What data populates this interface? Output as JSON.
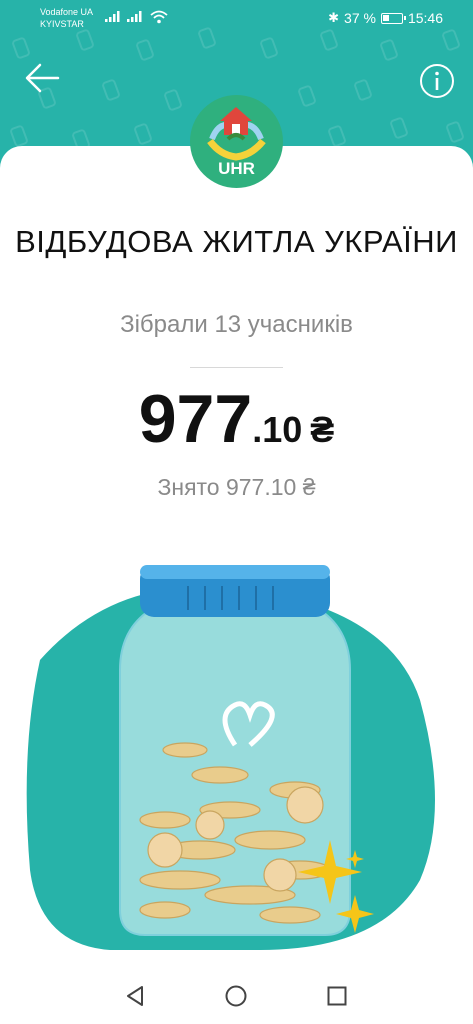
{
  "status_bar": {
    "carrier_1": "Vodafone UA",
    "carrier_2": "KYIVSTAR",
    "battery_percent": "37 %",
    "time": "15:46"
  },
  "header": {
    "back_icon": "arrow-left-icon",
    "info_icon": "info-circle-icon",
    "accent_color": "#27b3a9"
  },
  "jar": {
    "logo_text": "UHR",
    "title": "ВІДБУДОВА ЖИТЛА УКРАЇНИ",
    "participants": "Зібрали 13 учасників",
    "amount_int": "977",
    "amount_dec": ".10",
    "currency": "₴",
    "withdrawn": "Знято 977.10 ₴"
  },
  "nav": {
    "back_icon": "triangle-back-icon",
    "home_icon": "circle-home-icon",
    "recents_icon": "square-recents-icon"
  }
}
